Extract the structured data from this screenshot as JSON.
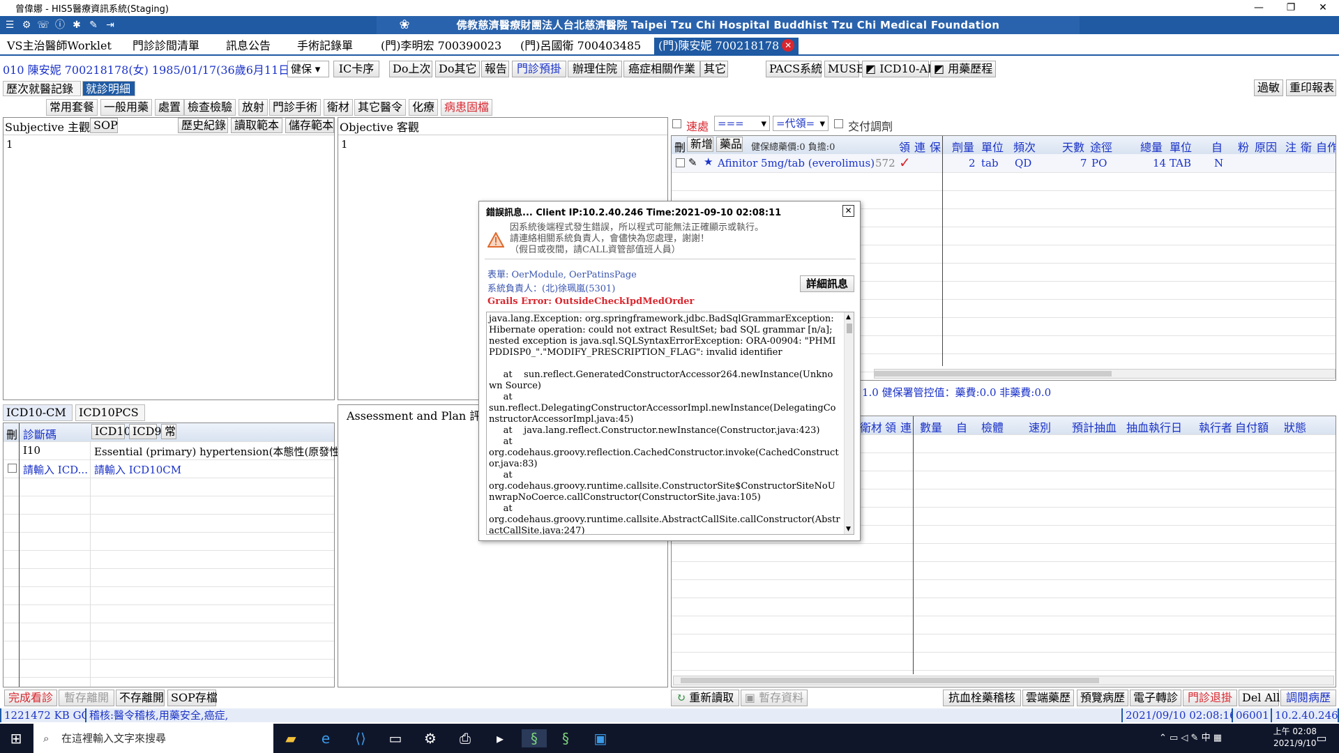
{
  "window": {
    "title": "曾偉娜 - HIS5醫療資訊系統(Staging)",
    "controls": [
      "—",
      "❐",
      "✕"
    ]
  },
  "banner": {
    "hospital": "佛教慈濟醫療財團法人台北慈濟醫院 Taipei Tzu Chi Hospital Buddhist Tzu Chi Medical Foundation"
  },
  "top_tabs": [
    "VS主治醫師Worklet",
    "門診診間清單",
    "訊息公告",
    "手術記錄單",
    "(門)李明宏 700390023",
    "(門)呂國衛 700403485",
    "(門)陳安妮 700218178"
  ],
  "patient": {
    "info": "010  陳安妮 700218178(女) 1985/01/17(36歲6月11日)",
    "insurance": "健保",
    "buttons": [
      "IC卡序",
      "Do上次",
      "Do其它",
      "報告",
      "門診預掛",
      "辦理住院",
      "癌症相關作業",
      "其它",
      "PACS系統",
      "MUSE",
      "ICD10-AI",
      "用藥歷程"
    ]
  },
  "sub_tabs": [
    "歷次就醫記錄",
    "就診明細"
  ],
  "right_top_buttons": [
    "過敏",
    "重印報表"
  ],
  "order_tabs": [
    "常用套餐",
    "一般用藥",
    "處置",
    "檢查檢驗",
    "放射",
    "門診手術",
    "衛材",
    "其它醫令",
    "化療",
    "病患固檔"
  ],
  "subjective": {
    "title": "Subjective 主觀",
    "sop": "SOP",
    "history": "歷史紀錄",
    "read_template": "讀取範本",
    "save_template": "儲存範本",
    "content": "1"
  },
  "objective": {
    "title": "Objective 客觀",
    "content": "1"
  },
  "diagnosis": {
    "tabs": [
      "ICD10-CM",
      "ICD10PCS"
    ],
    "header_del": "刪",
    "header_code": "診斷碼",
    "header_buttons": [
      "ICD10",
      "ICD9",
      "常"
    ],
    "rows": [
      {
        "code": "I10",
        "desc": "Essential (primary) hypertension(本態性(原發性)高..."
      },
      {
        "code": "請輸入 ICD...",
        "desc": "請輸入 ICD10CM"
      }
    ]
  },
  "assessment": {
    "title": "Assessment and Plan 評估"
  },
  "med": {
    "urgent": "速處",
    "filter1": "===",
    "filter2": "=代領=",
    "deliver": "交付調劑",
    "header_del": "刪",
    "add": "新增",
    "drug": "藥品",
    "insurance_total": "健保總藥價:0 負擔:0",
    "cols": [
      "領",
      "連",
      "保",
      "劑量",
      "單位",
      "頻次",
      "天數",
      "途徑",
      "總量",
      "單位",
      "自",
      "粉",
      "原因",
      "注",
      "衛",
      "自作"
    ],
    "row": {
      "name": "Afinitor 5mg/tab (everolimus)",
      "code": "572",
      "dose": "2",
      "unit": "tab",
      "freq": "QD",
      "days": "7",
      "route": "PO",
      "total": "14",
      "tunit": "TAB",
      "self": "N"
    },
    "control": "1.0 健保署管控值：藥費:0.0 非藥費:0.0"
  },
  "lab": {
    "cols": [
      "衛材",
      "領",
      "連",
      "數量",
      "自",
      "檢體",
      "速別",
      "預計抽血",
      "抽血執行日",
      "執行者",
      "自付額",
      "狀態"
    ]
  },
  "bottom_left_buttons": [
    "完成看診",
    "暫存離開",
    "不存離開",
    "SOP存檔"
  ],
  "bottom_mid_buttons": [
    "重新讀取",
    "暫存資料"
  ],
  "bottom_right_buttons": [
    "抗血栓藥稽核",
    "雲端藥歷",
    "預覽病歷",
    "電子轉診",
    "門診退掛",
    "Del All",
    "調閱病歷"
  ],
  "status": {
    "memory": "1221472 KB  GC",
    "audit": "稽核:醫令稽核,用藥安全,癌症,",
    "datetime": "2021/09/10 02:08:16",
    "code": "06001",
    "ip": "10.2.40.246"
  },
  "dialog": {
    "title": "錯誤訊息... Client IP:10.2.40.246  Time:2021-09-10 02:08:11",
    "message": "因系統後端程式發生錯誤，所以程式可能無法正確顯示或執行。\n請連絡相關系統負責人，會儘快為您處理，謝謝！\n（假日或夜間，請CALL資管部值班人員）",
    "form": "表單:   OerModule, OerPatinsPage",
    "owner": "系統負責人：(北)徐珮嵐(5301)",
    "details": "詳細訊息",
    "error": "Grails Error: OutsideCheckIpdMedOrder",
    "trace": "java.lang.Exception: org.springframework.jdbc.BadSqlGrammarException: Hibernate operation: could not extract ResultSet; bad SQL grammar [n/a]; nested exception is java.sql.SQLSyntaxErrorException: ORA-00904: \"PHMIPDDISP0_\".\"MODIFY_PRESCRIPTION_FLAG\": invalid identifier\n\n     at    sun.reflect.GeneratedConstructorAccessor264.newInstance(Unknown Source)\n     at\nsun.reflect.DelegatingConstructorAccessorImpl.newInstance(DelegatingConstructorAccessorImpl.java:45)\n     at    java.lang.reflect.Constructor.newInstance(Constructor.java:423)\n     at\norg.codehaus.groovy.reflection.CachedConstructor.invoke(CachedConstructor.java:83)\n     at\norg.codehaus.groovy.runtime.callsite.ConstructorSite$ConstructorSiteNoUnwrapNoCoerce.callConstructor(ConstructorSite.java:105)\n     at\norg.codehaus.groovy.runtime.callsite.AbstractCallSite.callConstructor(AbstractCallSite.java:247)\n      at"
  },
  "taskbar": {
    "search": "在這裡輸入文字來搜尋",
    "time": "上午 02:08",
    "date": "2021/9/10",
    "ime": "中"
  }
}
